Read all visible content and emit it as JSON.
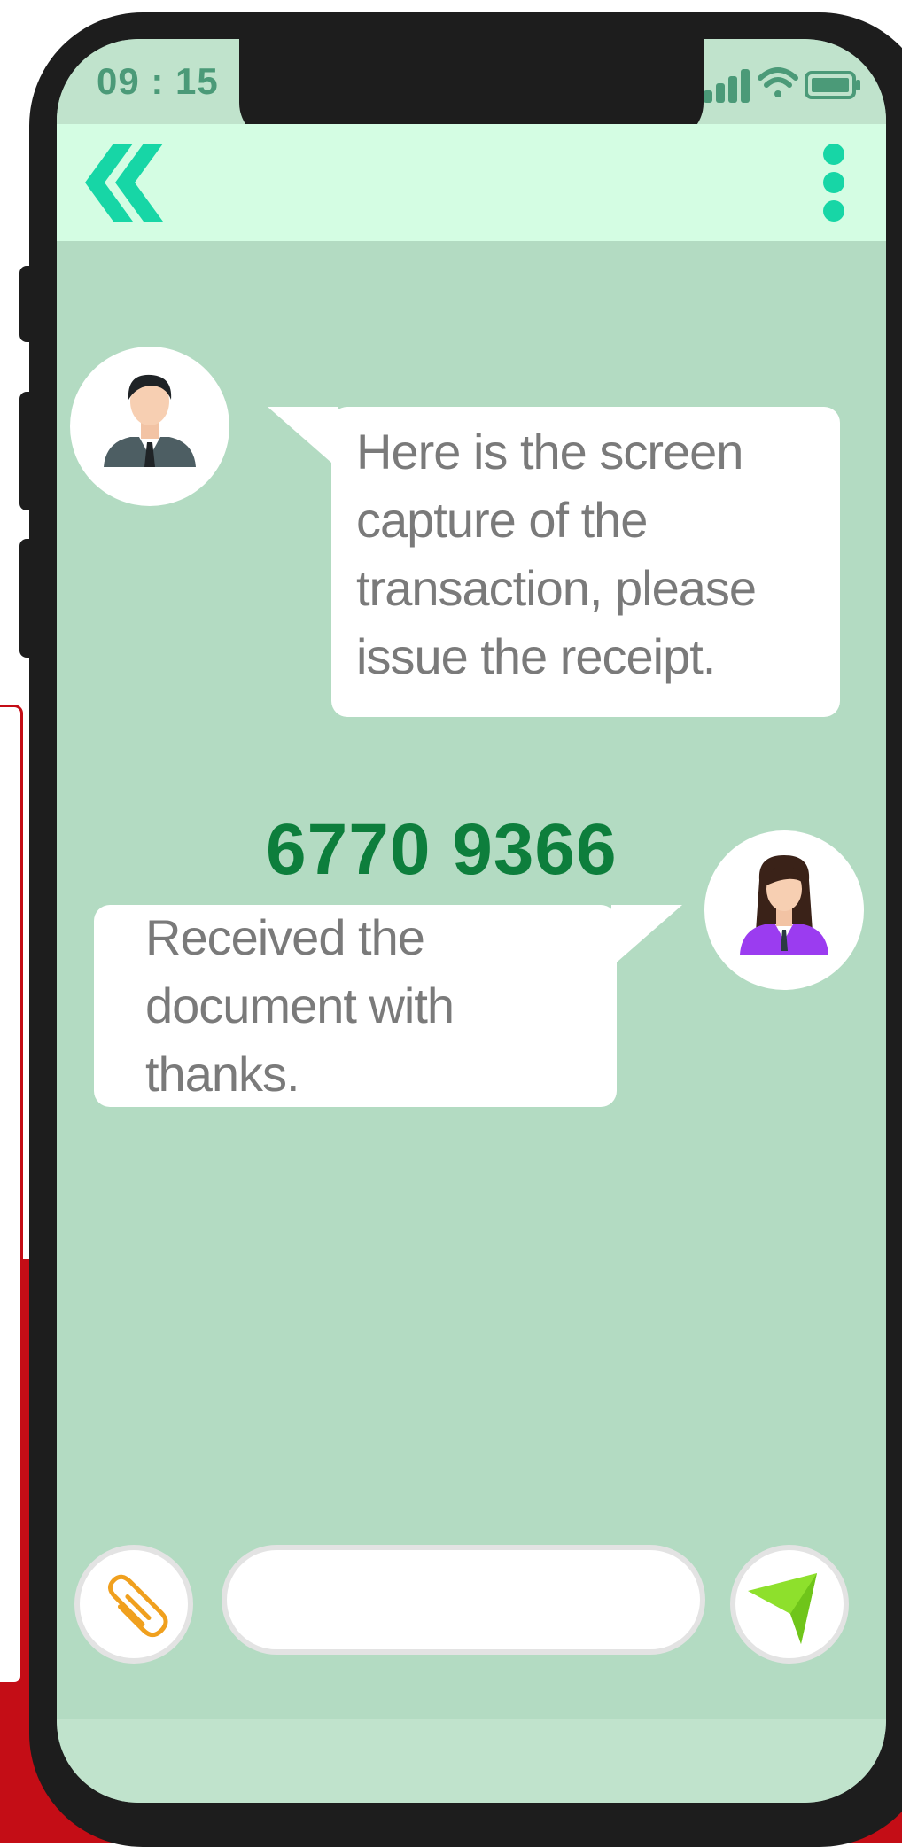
{
  "status_bar": {
    "time": "09 : 15",
    "icons": [
      "signal-icon",
      "wifi-icon",
      "battery-icon"
    ]
  },
  "header": {
    "back_icon": "double-chevron-left-icon",
    "menu_icon": "kebab-menu-icon"
  },
  "messages": [
    {
      "sender": "male-businessman-avatar",
      "side": "left-avatar",
      "lines": [
        "Here is the screen",
        "capture of the",
        "transaction, please",
        "issue the receipt."
      ]
    },
    {
      "sender": "female-businesswoman-avatar",
      "side": "right-avatar",
      "lines": [
        "Received the",
        "document with",
        "thanks."
      ]
    }
  ],
  "phone_number": "6770 9366",
  "composer": {
    "attach_icon": "paperclip-icon",
    "input_value": "",
    "input_placeholder": "",
    "send_icon": "send-arrow-icon"
  },
  "colors": {
    "screen_bg": "#b3dbc2",
    "header_bg": "#d4fde3",
    "accent_teal": "#17d6a6",
    "phone_number": "#0d7e3c",
    "bubble_text": "#7a7a7a",
    "background_red": "#c40d16"
  }
}
